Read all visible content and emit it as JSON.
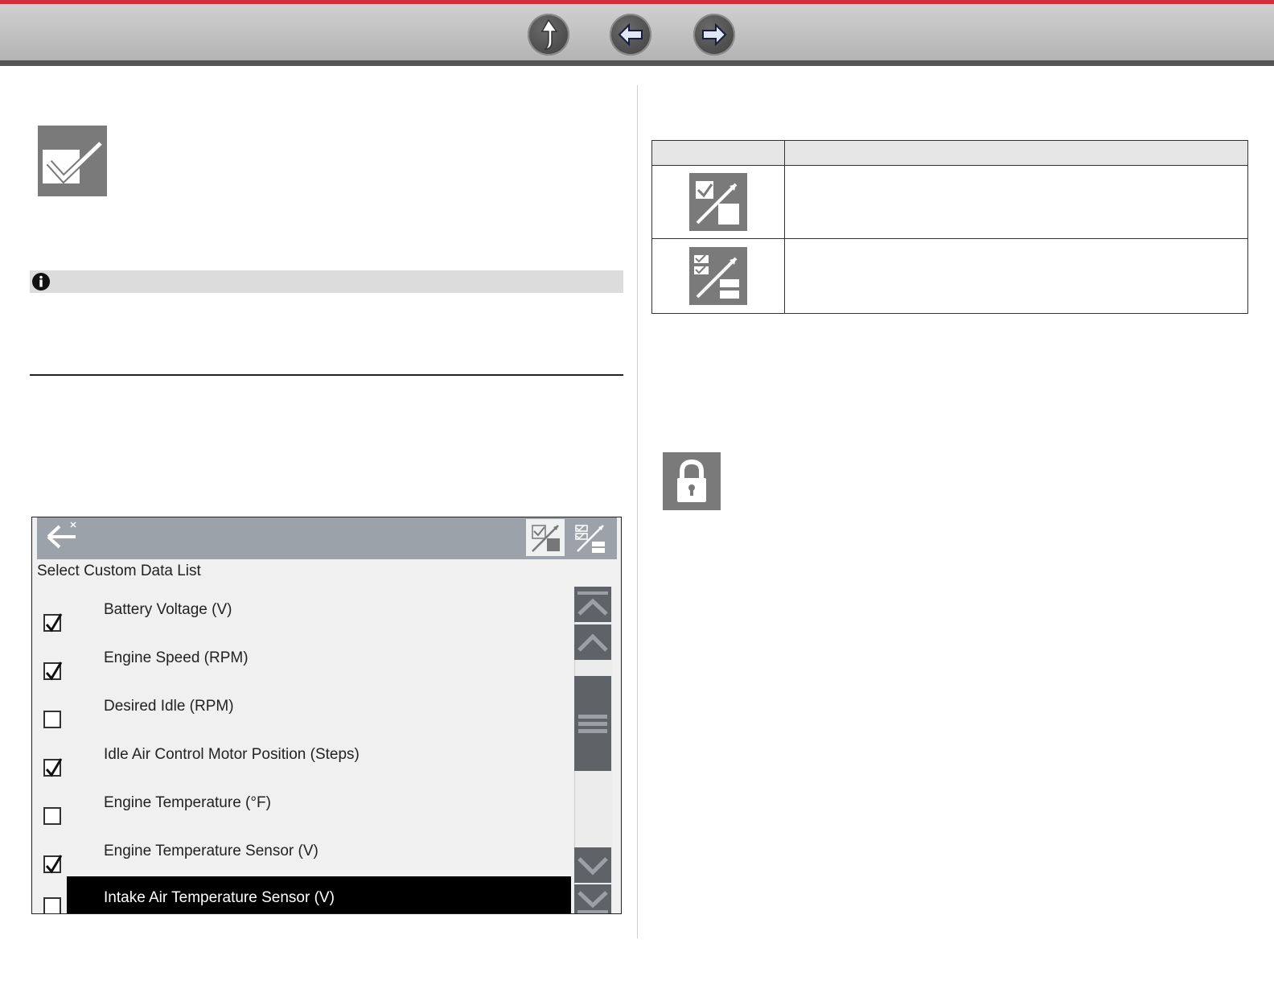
{
  "header": {
    "buttons": [
      {
        "name": "home-up-icon"
      },
      {
        "name": "back-arrow-icon"
      },
      {
        "name": "forward-arrow-icon"
      }
    ]
  },
  "icons": {
    "checkbox_feature": "checkbox-icon",
    "info": "info-icon",
    "lock": "lock-icon",
    "table_row1": "select-deselect-icon",
    "table_row2": "select-all-deselect-all-icon"
  },
  "device": {
    "title": "Select Custom Data List",
    "items": [
      {
        "label": "Battery Voltage (V)",
        "checked": true
      },
      {
        "label": "Engine Speed (RPM)",
        "checked": true
      },
      {
        "label": "Desired Idle (RPM)",
        "checked": false
      },
      {
        "label": "Idle Air Control Motor Position (Steps)",
        "checked": true
      },
      {
        "label": "Engine Temperature (°F)",
        "checked": false
      },
      {
        "label": "Engine Temperature Sensor (V)",
        "checked": true
      },
      {
        "label": "Intake Air Temperature Sensor (V)",
        "checked": false,
        "selected": true
      }
    ]
  },
  "colors": {
    "accent_red": "#d42e3b",
    "toolbar_gray": "#9ba2aa",
    "icon_gray": "#7a7a7a"
  }
}
